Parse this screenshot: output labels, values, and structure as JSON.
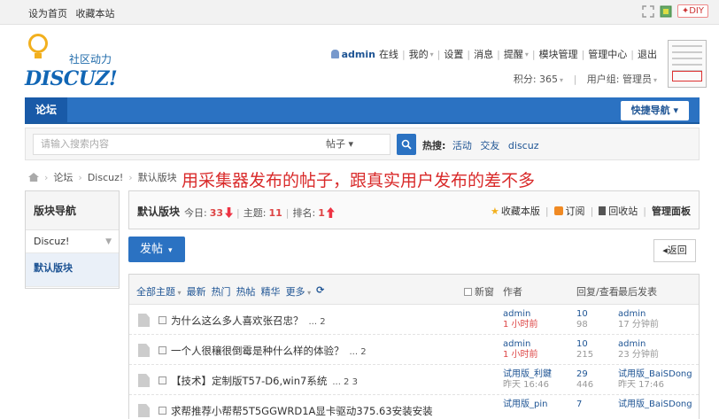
{
  "topbar": {
    "set_home": "设为首页",
    "bookmark": "收藏本站",
    "diy": "DIY"
  },
  "header": {
    "logo_tagline": "社区动力",
    "logo_brand": "DISCUZ!",
    "user": "admin",
    "status": "在线",
    "nav": [
      "我的",
      "设置",
      "消息",
      "提醒",
      "模块管理",
      "管理中心",
      "退出"
    ],
    "points": "积分: 365",
    "user_group": "用户组: 管理员"
  },
  "navbar": {
    "forum": "论坛",
    "quick_nav": "快捷导航 ▾"
  },
  "search": {
    "placeholder": "请输入搜索内容",
    "type": "帖子 ▾",
    "hot_label": "热搜:",
    "hot_terms": [
      "活动",
      "交友",
      "discuz"
    ]
  },
  "breadcrumb": [
    "论坛",
    "Discuz!",
    "默认版块"
  ],
  "annotation": "用采集器发布的帖子，跟真实用户发布的差不多",
  "sidebar": {
    "title": "版块导航",
    "items": [
      {
        "label": "Discuz!"
      },
      {
        "label": "默认版块"
      }
    ]
  },
  "forum": {
    "title": "默认版块",
    "today_label": "今日:",
    "today": "33",
    "topics_label": "主题:",
    "topics": "11",
    "rank_label": "排名:",
    "rank": "1",
    "favorite": "收藏本版",
    "subscribe": "订阅",
    "recycle": "回收站",
    "manage": "管理面板"
  },
  "actions": {
    "post": "发帖",
    "back": "◂返回"
  },
  "filter": {
    "categories": [
      "全部主题",
      "最新",
      "热门",
      "热帖",
      "精华",
      "更多"
    ],
    "new_window": "新窗",
    "author": "作者",
    "stats": "回复/查看",
    "last_post": "最后发表"
  },
  "threads": [
    {
      "subject": "为什么这么多人喜欢张召忠？",
      "pages": "... 2",
      "author": "admin",
      "time": "1 小时前",
      "replies": "10",
      "views": "98",
      "last_user": "admin",
      "last_time": "17 分钟前"
    },
    {
      "subject": "一个人很穰很倒霉是种什么样的体验？",
      "pages": "... 2",
      "author": "admin",
      "time": "1 小时前",
      "replies": "10",
      "views": "215",
      "last_user": "admin",
      "last_time": "23 分钟前"
    },
    {
      "subject": "【技术】定制版T57-D6,win7系统",
      "pages": "... 2  3",
      "author": "试用版_利鍵",
      "time": "昨天 16:46",
      "replies": "29",
      "views": "446",
      "last_user": "试用版_BaiSDong",
      "last_time": "昨天 17:46"
    },
    {
      "subject": "求帮推荐小帮帮5T5GGWRD1A显卡驱动375.63安装安装",
      "pages": "",
      "author": "试用版_pin",
      "time": "",
      "replies": "7",
      "views": "",
      "last_user": "试用版_BaiSDong",
      "last_time": ""
    }
  ]
}
